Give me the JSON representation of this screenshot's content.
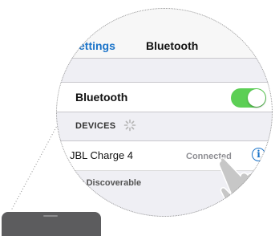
{
  "nav": {
    "back_label": "ettings",
    "title": "Bluetooth"
  },
  "bluetooth_row": {
    "label": "Bluetooth",
    "toggle_on": true
  },
  "devices_section": {
    "header": "DEVICES"
  },
  "device": {
    "name": "JBL Charge 4",
    "status": "Connected",
    "info_glyph": "i"
  },
  "footer": {
    "text": "w Discoverable"
  },
  "icons": {
    "spinner": "spinner-icon",
    "info": "info-icon",
    "hand": "pointing-hand-icon"
  },
  "colors": {
    "accent": "#1a73c9",
    "toggle_on": "#5ccf55",
    "background": "#efeff4"
  }
}
